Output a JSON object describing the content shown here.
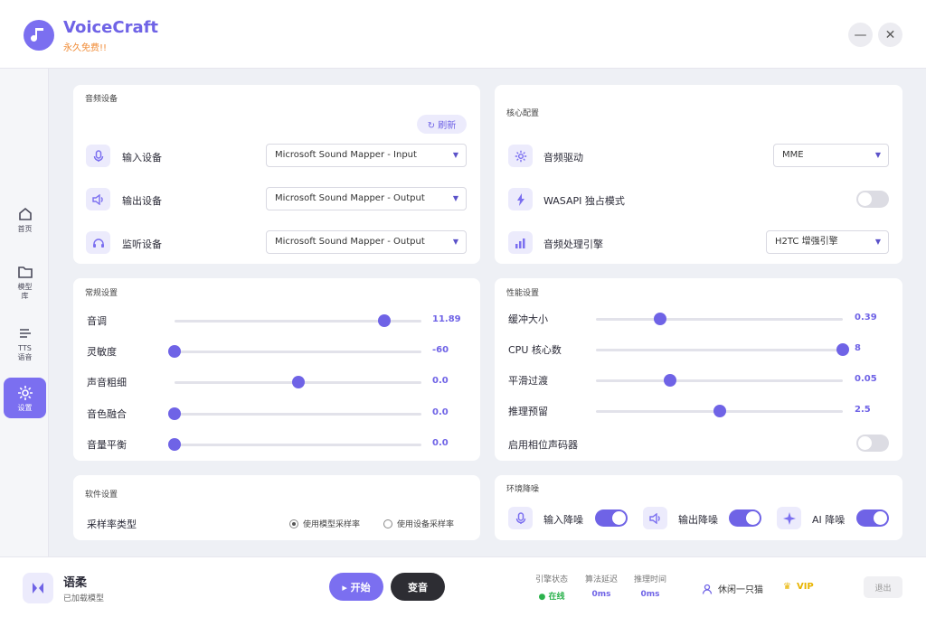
{
  "app": {
    "title": "VoiceCraft",
    "subtitle": "永久免费!!",
    "minimize": "—",
    "close": "✕"
  },
  "sidebar": {
    "items": [
      {
        "label": "首页",
        "icon": "home-icon"
      },
      {
        "label": "模型\n库",
        "icon": "folder-icon"
      },
      {
        "label": "TTS\n语音",
        "icon": "tts-icon"
      },
      {
        "label": "设置",
        "icon": "gear-icon",
        "active": true
      }
    ]
  },
  "audio_devices": {
    "title": "音频设备",
    "refresh": "↻ 刷新",
    "rows": [
      {
        "label": "输入设备",
        "icon": "microphone-icon",
        "value": "Microsoft Sound Mapper - Input"
      },
      {
        "label": "输出设备",
        "icon": "speaker-icon",
        "value": "Microsoft Sound Mapper - Output"
      },
      {
        "label": "监听设备",
        "icon": "headphone-icon",
        "value": "Microsoft Sound Mapper - Output"
      }
    ]
  },
  "core_config": {
    "title": "核心配置",
    "rows": [
      {
        "label": "音频驱动",
        "icon": "gear-icon",
        "value": "MME"
      },
      {
        "label": "WASAPI 独占模式",
        "icon": "lightning-icon",
        "toggle": false
      },
      {
        "label": "音频处理引擎",
        "icon": "bar-chart-icon",
        "value": "H2TC 增强引擎"
      }
    ]
  },
  "general": {
    "title": "常规设置",
    "sliders": [
      {
        "label": "音调",
        "value": "11.89",
        "fraction": 0.85
      },
      {
        "label": "灵敏度",
        "value": "-60",
        "fraction": 0.0
      },
      {
        "label": "声音粗细",
        "value": "0.0",
        "fraction": 0.5
      },
      {
        "label": "音色融合",
        "value": "0.0",
        "fraction": 0.0
      },
      {
        "label": "音量平衡",
        "value": "0.0",
        "fraction": 0.0
      }
    ]
  },
  "performance": {
    "title": "性能设置",
    "sliders": [
      {
        "label": "缓冲大小",
        "value": "0.39",
        "fraction": 0.26
      },
      {
        "label": "CPU 核心数",
        "value": "8",
        "fraction": 1.0
      },
      {
        "label": "平滑过渡",
        "value": "0.05",
        "fraction": 0.3
      },
      {
        "label": "推理预留",
        "value": "2.5",
        "fraction": 0.5
      }
    ],
    "toggle": {
      "label": "启用相位声码器",
      "on": false
    }
  },
  "software": {
    "title": "软件设置",
    "label": "采样率类型",
    "options": [
      {
        "label": "使用模型采样率",
        "selected": true
      },
      {
        "label": "使用设备采样率",
        "selected": false
      }
    ]
  },
  "noise": {
    "title": "环境降噪",
    "items": [
      {
        "label": "输入降噪",
        "icon": "microphone-icon",
        "on": true
      },
      {
        "label": "输出降噪",
        "icon": "speaker-icon",
        "on": true
      },
      {
        "label": "AI 降噪",
        "icon": "sparkle-icon",
        "on": true
      }
    ]
  },
  "footer": {
    "model_name": "语柔",
    "model_status": "已加载模型",
    "start": "▸ 开始",
    "voice_change": "变音",
    "stats": [
      {
        "label": "引擎状态",
        "value": "● 在线",
        "color": "#2bb24c"
      },
      {
        "label": "算法延迟",
        "value": "0ms",
        "color": "#6f63e6"
      },
      {
        "label": "推理时间",
        "value": "0ms",
        "color": "#6f63e6"
      }
    ],
    "user": "休闲一只猫",
    "vip": "VIP",
    "logout": "退出"
  },
  "colors": {
    "accent": "#6f63e6",
    "vip": "#e8b400"
  }
}
